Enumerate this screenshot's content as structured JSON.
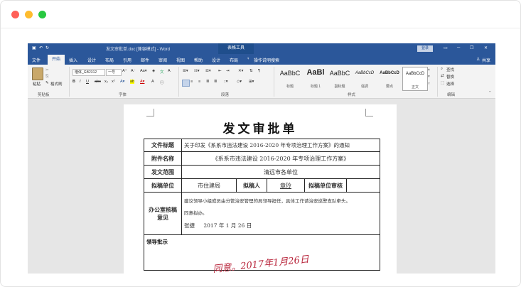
{
  "window": {
    "dot_colors": [
      "#ff5f57",
      "#febc2e",
      "#28c840"
    ]
  },
  "word": {
    "title_bar": {
      "file": "发文审批单.doc [兼容模式] - Word",
      "context": "表格工具",
      "login": "登录"
    },
    "tabs": [
      "文件",
      "开始",
      "插入",
      "设计",
      "布局",
      "引用",
      "邮件",
      "审阅",
      "视图",
      "帮助",
      "设计",
      "布局"
    ],
    "active_tab": "开始",
    "tell_me": "操作说明搜索",
    "share": "共享",
    "groups": {
      "clipboard": "剪贴板",
      "font": "字体",
      "paragraph": "段落",
      "styles": "样式",
      "editing": "编辑"
    },
    "clipboard": {
      "paste": "粘贴",
      "format_painter": "格式刷"
    },
    "font": {
      "name": "楷体_GB2312",
      "size": "一号"
    },
    "styles": [
      {
        "sample": "AaBbC",
        "name": "标题"
      },
      {
        "sample": "AaBl",
        "name": "标题 1"
      },
      {
        "sample": "AaBbC",
        "name": "副标题"
      },
      {
        "sample": "AaBbCcD",
        "name": "强调"
      },
      {
        "sample": "AaBbCcD",
        "name": "要点"
      },
      {
        "sample": "AaBbCcD",
        "name": "正文"
      }
    ],
    "editing": {
      "find": "查找",
      "replace": "替换",
      "select": "选择"
    }
  },
  "document": {
    "title": "发文审批单",
    "rows": {
      "doc_title_label": "文件标题",
      "doc_title_value": "关于印发《系系市违法建设 2016-2020 年专项治理工作方案》的通知",
      "attachment_label": "附件名称",
      "attachment_value": "《系系市违法建设 2016-2020 年专项治理工作方案》",
      "scope_label": "发文范围",
      "scope_value": "清远市各单位",
      "draft_unit_label": "拟稿单位",
      "draft_unit_value": "市住建局",
      "drafter_label": "拟稿人",
      "drafter_value": "章玲",
      "draft_review_label": "拟稿单位审核",
      "office_label": "办公室核稿意见",
      "office_opinion_1": "建议领导小组成员由分管治安管理的局领导担任，具体工作请治安巡警支队牵头。",
      "office_opinion_2": "同意拟办。",
      "office_signer": "张捷",
      "office_date": "2017 年 1 月 26 日",
      "leader_label": "领导批示",
      "leader_signature": "同意。2017年1月26日"
    }
  }
}
